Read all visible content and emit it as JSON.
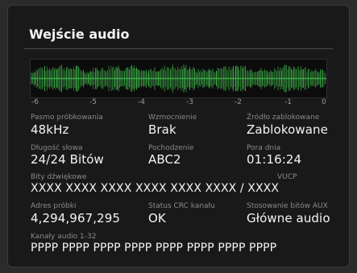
{
  "panel": {
    "title": "Wejście audio"
  },
  "meter": {
    "scale_labels": [
      "-6",
      "-5",
      "-4",
      "-3",
      "-2",
      "-1",
      "0"
    ],
    "waveform_color": "#3aa845"
  },
  "fields": {
    "sample_rate": {
      "label": "Pasmo próbkowania",
      "value": "48kHz"
    },
    "gain": {
      "label": "Wzmocnienie",
      "value": "Brak"
    },
    "lock_source": {
      "label": "Źródło zablokowane",
      "value": "Zablokowane"
    },
    "word_length": {
      "label": "Długość słowa",
      "value": "24/24 Bitów"
    },
    "origin": {
      "label": "Pochodzenie",
      "value": "ABC2"
    },
    "time_of_day": {
      "label": "Pora dnia",
      "value": "01:16:24"
    },
    "audio_bits": {
      "label": "Bity dźwiękowe",
      "value": "XXXX XXXX XXXX XXXX XXXX XXXX / XXXX"
    },
    "vucp": {
      "label": "VUCP"
    },
    "sample_address": {
      "label": "Adres próbki",
      "value": "4,294,967,295"
    },
    "crc_status": {
      "label": "Status CRC kanału",
      "value": "OK"
    },
    "aux_bits": {
      "label": "Stosowanie bitów AUX",
      "value": "Główne audio"
    },
    "channels": {
      "label": "Kanały audio 1-32",
      "value": "PPPP PPPP PPPP PPPP PPPP PPPP PPPP PPPP"
    }
  }
}
